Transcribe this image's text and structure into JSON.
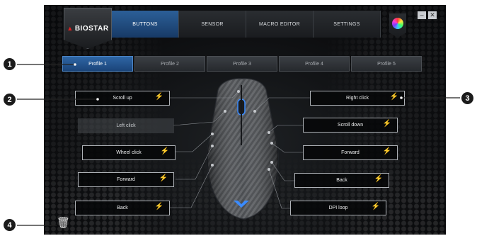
{
  "brand": {
    "name": "BIOSTAR"
  },
  "tabs": [
    {
      "label": "BUTTONS",
      "active": true
    },
    {
      "label": "SENSOR",
      "active": false
    },
    {
      "label": "MACRO EDITOR",
      "active": false
    },
    {
      "label": "SETTINGS",
      "active": false
    }
  ],
  "window": {
    "minimize_symbol": "–",
    "close_symbol": "✕"
  },
  "profiles": [
    "Profile 1",
    "Profile 2",
    "Profile 3",
    "Profile 4",
    "Profile 5"
  ],
  "active_profile": "Profile 1",
  "left_buttons": [
    "Scroll up",
    "Left click",
    "Wheel click",
    "Forward",
    "Back"
  ],
  "right_buttons": [
    "Right click",
    "Scroll down",
    "Forward",
    "Back",
    "DPI loop"
  ],
  "markers": [
    "1",
    "2",
    "3",
    "4"
  ],
  "icons": {
    "bolt": "⚡",
    "trash": "🗑"
  },
  "colors": {
    "accent": "#2c5f98",
    "mouse_led": "#3a8bff"
  }
}
